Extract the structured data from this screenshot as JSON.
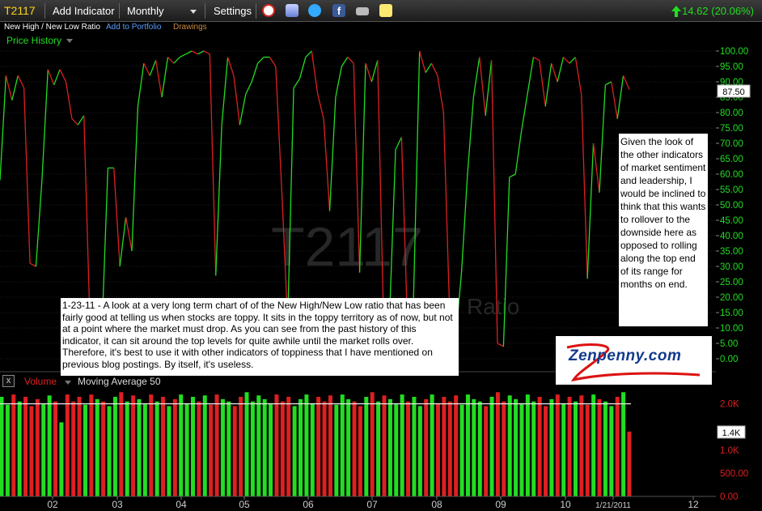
{
  "toolbar": {
    "symbol": "T2117",
    "add_indicator": "Add Indicator",
    "period": "Monthly",
    "settings": "Settings",
    "change": "14.62 (20.06%)",
    "icons": [
      "alarm-clock-icon",
      "bookmark-icon",
      "twitter-icon",
      "facebook-icon",
      "camera-icon",
      "sticky-note-icon"
    ]
  },
  "subbar": {
    "title": "New High / New Low Ratio",
    "add_portfolio": "Add to Portfolio",
    "drawings": "Drawings"
  },
  "legend": {
    "price_history": "Price History"
  },
  "watermark": {
    "symbol": "T2117",
    "name": "Ratio"
  },
  "price_axis": {
    "labels": [
      "100.00",
      "95.00",
      "90.00",
      "85.00",
      "80.00",
      "75.00",
      "70.00",
      "65.00",
      "60.00",
      "55.00",
      "50.00",
      "45.00",
      "40.00",
      "35.00",
      "30.00",
      "25.00",
      "20.00",
      "15.00",
      "10.00",
      "5.00",
      "0.00"
    ],
    "current": "87.50"
  },
  "volume_panel": {
    "close_glyph": "x",
    "volume_label": "Volume",
    "ma_label": "Moving Average 50",
    "axis_labels": [
      "2.0K",
      "1.0K",
      "500.00",
      "0.00"
    ],
    "current": "1.4K"
  },
  "time_axis": {
    "labels": [
      "02",
      "03",
      "04",
      "05",
      "06",
      "07",
      "08",
      "09",
      "10",
      "1/21/2011",
      "12"
    ]
  },
  "notes": {
    "main": "1-23-11 - A look at a very long term chart of of the New High/New Low ratio that has been fairly good at telling us when stocks are toppy. It sits in the toppy territory as of now, but not at a point where the market must drop. As you can see from the past history of this indicator, it can sit around the top levels for quite awhile until the market rolls over. Therefore, it's best to use it with other indicators of toppiness that I have mentioned on previous blog postings. By itself, it's useless.",
    "side": "Given the look of the other indicators of market sentiment and leadership, I would be inclined to think that this wants to rollover to the downside here as opposed to rolling along the top end of its range for months on end."
  },
  "logo": {
    "text": "Zenpenny.com"
  },
  "colors": {
    "up": "#22dd22",
    "down": "#dd2020",
    "accent": "#ffd51a",
    "link": "#5aa0ff",
    "drawings": "#c98a3a"
  },
  "chart_data": {
    "type": "line",
    "title": "",
    "xlabel": "",
    "ylabel": "",
    "ylim": [
      0,
      100
    ],
    "series": [
      {
        "values": [
          58,
          92,
          84,
          92,
          88,
          31,
          30,
          58,
          94,
          89,
          94,
          90,
          78,
          76,
          79,
          12,
          14,
          9,
          62,
          62,
          30,
          46,
          35,
          82,
          96,
          92,
          97,
          85,
          98,
          96,
          98,
          99,
          100,
          99,
          100,
          99,
          27,
          76,
          98,
          92,
          76,
          86,
          90,
          96,
          98,
          98,
          95,
          55,
          12,
          88,
          91,
          98,
          100,
          86,
          78,
          48,
          85,
          95,
          98,
          96,
          28,
          96,
          90,
          97,
          12,
          14,
          68,
          72,
          10,
          20,
          100,
          93,
          96,
          92,
          80,
          16,
          6,
          28,
          60,
          85,
          98,
          79,
          97,
          5,
          4,
          59,
          60,
          74,
          86,
          98,
          97,
          82,
          96,
          90,
          98,
          96,
          98,
          86,
          26,
          70,
          54,
          89,
          90,
          78,
          92,
          87.5
        ]
      }
    ],
    "volume": {
      "type": "bar",
      "ylim": [
        0,
        2500
      ],
      "ma50": 2000,
      "values": [
        2150,
        1980,
        2200,
        2050,
        2150,
        1950,
        2100,
        1990,
        2180,
        2050,
        1600,
        2200,
        2050,
        2150,
        1980,
        2200,
        2100,
        2050,
        1950,
        2150,
        2250,
        2050,
        2180,
        2100,
        1990,
        2200,
        2050,
        2150,
        1950,
        2100,
        2200,
        2000,
        2150,
        2050,
        2180,
        1980,
        2200,
        2100,
        2050,
        1950,
        2150,
        2250,
        2050,
        2180,
        2100,
        1990,
        2200,
        2050,
        2150,
        1950,
        2100,
        2200,
        2000,
        2150,
        2050,
        2180,
        1980,
        2200,
        2100,
        2050,
        1950,
        2150,
        2250,
        2050,
        2180,
        2100,
        1990,
        2200,
        2050,
        2150,
        1950,
        2100,
        2200,
        2000,
        2150,
        2050,
        2180,
        1980,
        2200,
        2100,
        2050,
        1950,
        2150,
        2250,
        2050,
        2180,
        2100,
        1990,
        2200,
        2050,
        2150,
        1950,
        2100,
        2200,
        2000,
        2150,
        2050,
        2180,
        1980,
        2200,
        2100,
        2050,
        1950,
        2150,
        2250,
        1400
      ]
    }
  }
}
